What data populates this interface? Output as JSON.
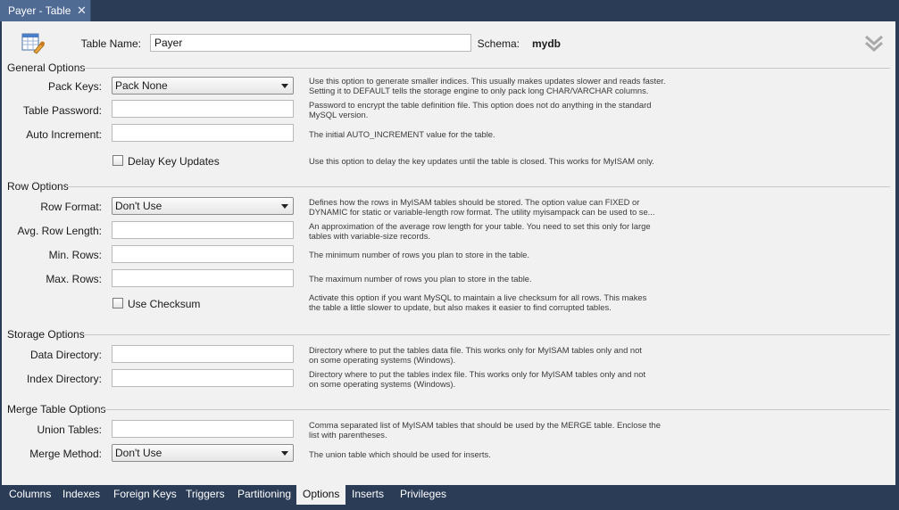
{
  "doc_tab": {
    "title": "Payer - Table",
    "close": "✕"
  },
  "header": {
    "table_name_label": "Table Name:",
    "table_name_value": "Payer",
    "schema_label": "Schema:",
    "schema_value": "mydb",
    "collapse_icon": "double-chevron-down"
  },
  "general": {
    "title": "General Options",
    "pack_keys": {
      "label": "Pack Keys:",
      "value": "Pack None",
      "desc1": "Use this option to generate smaller indices. This usually makes updates slower and reads faster.",
      "desc2": "Setting it to DEFAULT tells the storage engine to only pack long CHAR/VARCHAR columns."
    },
    "password": {
      "label": "Table Password:",
      "value": "",
      "desc1": "Password to encrypt the table definition file. This option does not do anything in the standard",
      "desc2": "MySQL version."
    },
    "auto_increment": {
      "label": "Auto Increment:",
      "value": "",
      "desc1": "The initial AUTO_INCREMENT value for the table."
    },
    "delay_key": {
      "label": "Delay Key Updates",
      "checked": false,
      "desc1": "Use this option to delay the key updates until the table is closed. This works for MyISAM only."
    }
  },
  "row": {
    "title": "Row Options",
    "row_format": {
      "label": "Row Format:",
      "value": "Don't Use",
      "desc1": "Defines how the rows in MyISAM tables should be stored. The option value can FIXED or",
      "desc2": "DYNAMIC for static or variable-length row format. The utility myisampack can be used to se..."
    },
    "avg_row": {
      "label": "Avg. Row Length:",
      "value": "",
      "desc1": "An approximation of the average row length for your table. You need to set this only for large",
      "desc2": "tables with variable-size records."
    },
    "min_rows": {
      "label": "Min. Rows:",
      "value": "",
      "desc1": "The minimum number of rows you plan to store in the table."
    },
    "max_rows": {
      "label": "Max. Rows:",
      "value": "",
      "desc1": "The maximum number of rows you plan to store in the table."
    },
    "checksum": {
      "label": "Use Checksum",
      "checked": false,
      "desc1": "Activate this option if you want MySQL to maintain a live checksum for all rows. This makes",
      "desc2": "the table a little slower to update, but also makes it easier to find corrupted tables."
    }
  },
  "storage": {
    "title": "Storage Options",
    "data_dir": {
      "label": "Data Directory:",
      "value": "",
      "desc1": "Directory where to put the tables data file. This works only for MyISAM tables only and not",
      "desc2": "on some operating systems (Windows)."
    },
    "index_dir": {
      "label": "Index Directory:",
      "value": "",
      "desc1": "Directory where to put the tables index file. This works only for MyISAM tables only and not",
      "desc2": "on some operating systems (Windows)."
    }
  },
  "merge": {
    "title": "Merge Table Options",
    "union": {
      "label": "Union Tables:",
      "value": "",
      "desc1": "Comma separated list of MyISAM tables that should be used by the MERGE table. Enclose the",
      "desc2": "list with parentheses."
    },
    "method": {
      "label": "Merge Method:",
      "value": "Don't Use",
      "desc1": "The union table which should be used for inserts."
    }
  },
  "bottom_tabs": {
    "columns": "Columns",
    "indexes": "Indexes",
    "foreign_keys": "Foreign Keys",
    "triggers": "Triggers",
    "partitioning": "Partitioning",
    "options": "Options",
    "inserts": "Inserts",
    "privileges": "Privileges",
    "active": "Options"
  },
  "colors": {
    "frame": "#2b3c57",
    "active_tab": "#4f6a93",
    "panel": "#f1f1f1"
  }
}
